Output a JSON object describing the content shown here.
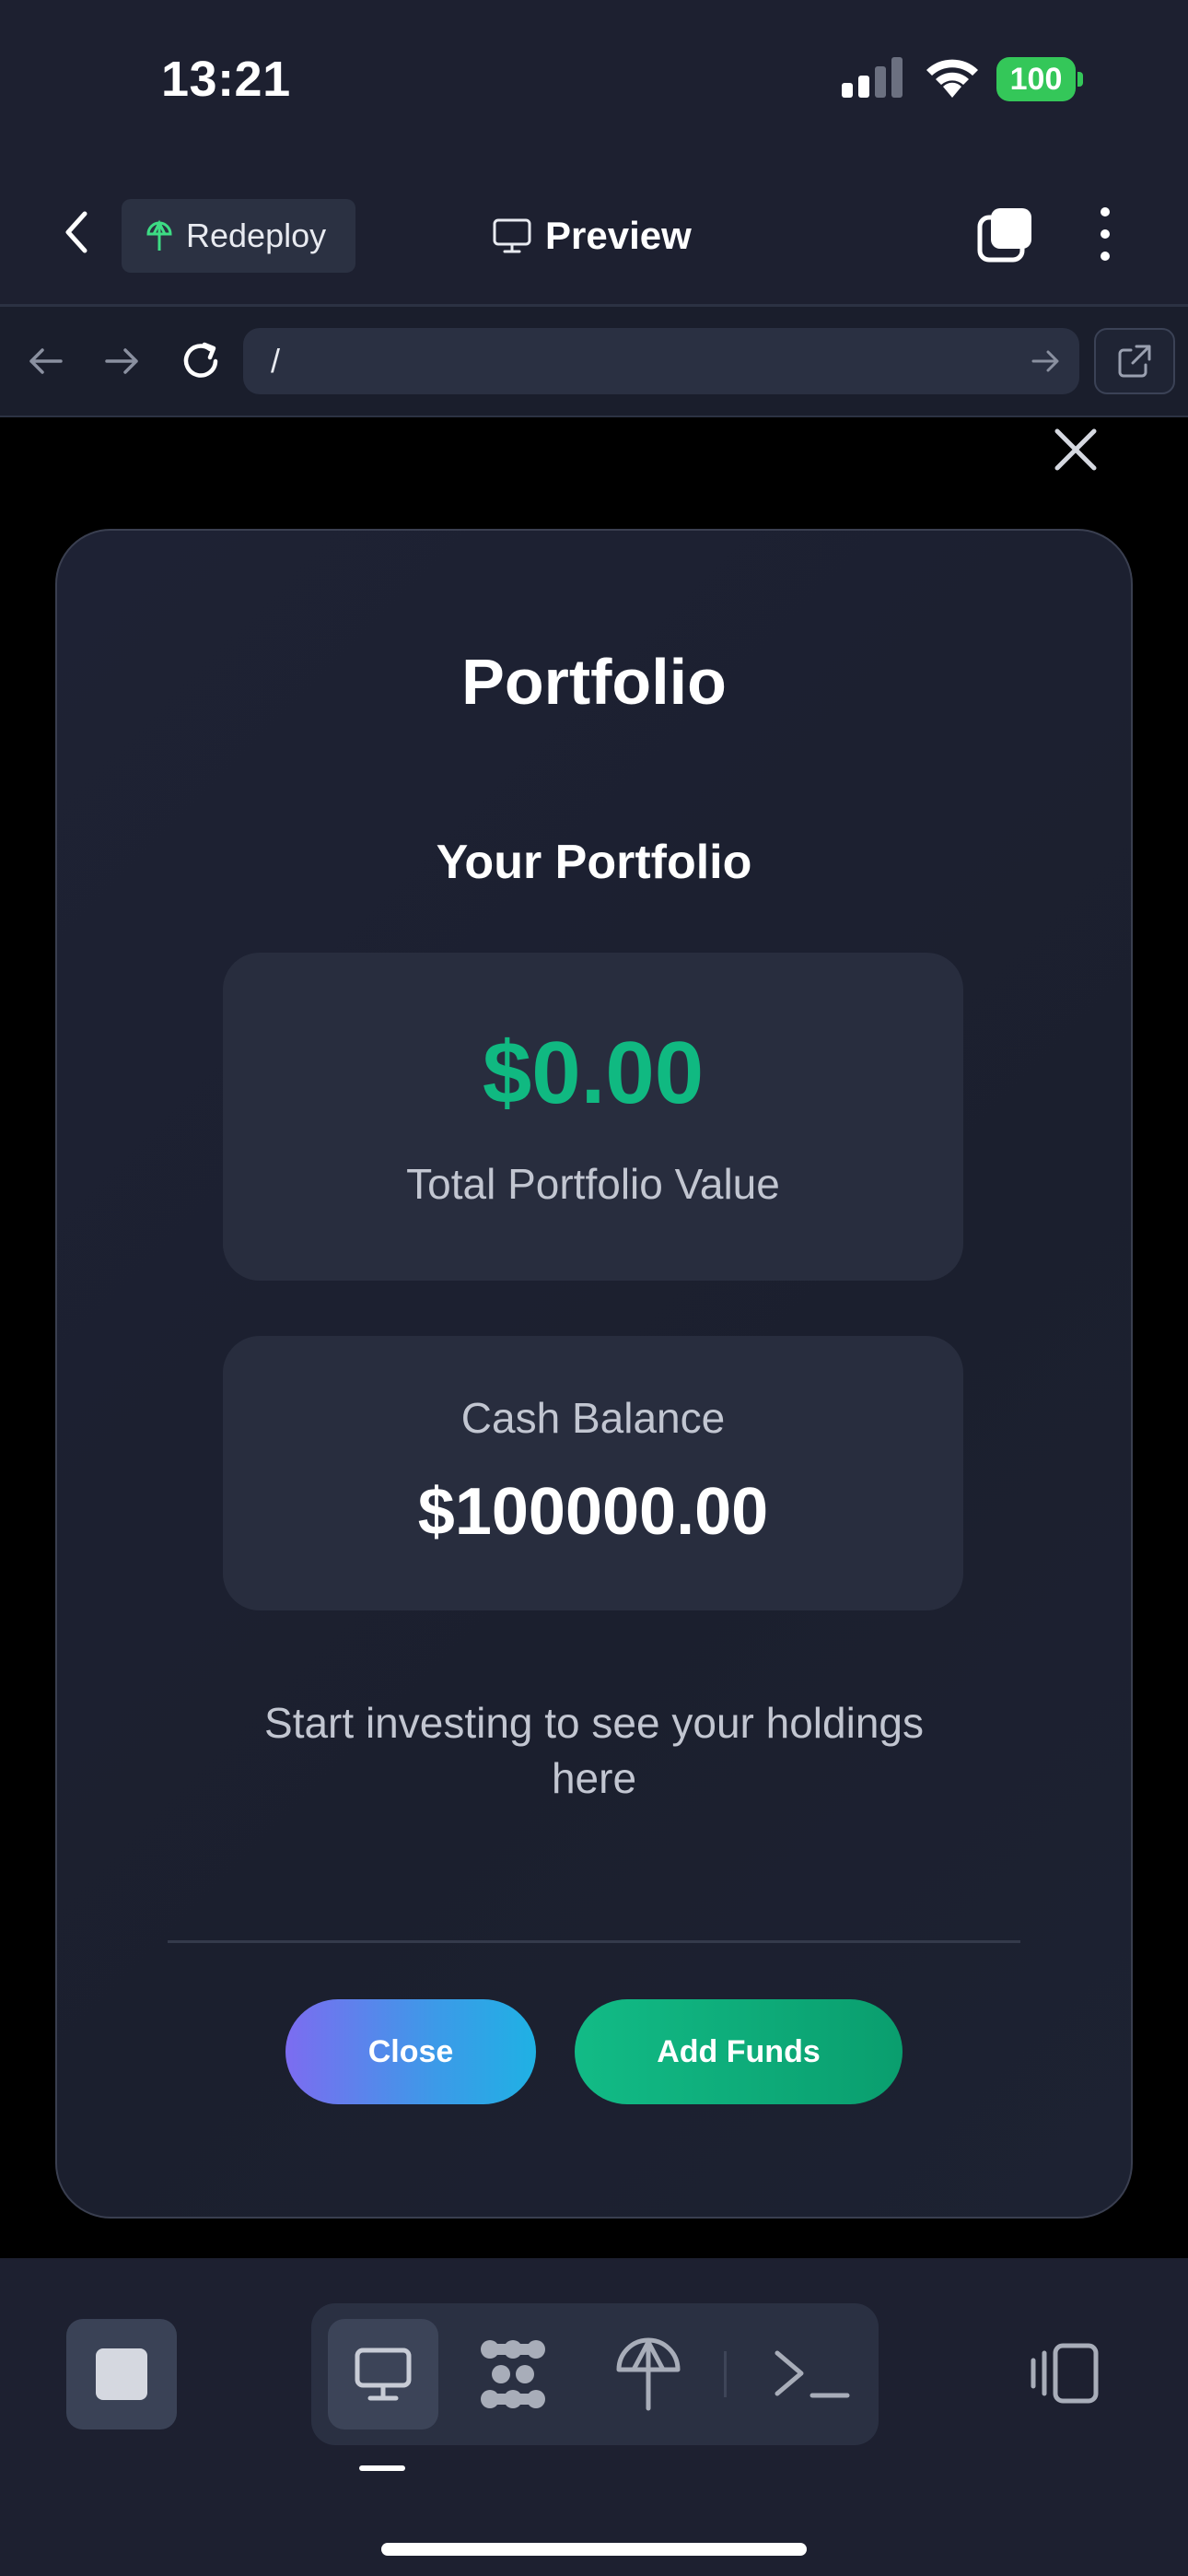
{
  "status_bar": {
    "time": "13:21",
    "battery": "100"
  },
  "header": {
    "redeploy_label": "Redeploy",
    "preview_label": "Preview"
  },
  "browser": {
    "url": "/"
  },
  "modal": {
    "title": "Portfolio",
    "section_title": "Your Portfolio",
    "total_value": "$0.00",
    "total_label": "Total Portfolio Value",
    "cash_label": "Cash Balance",
    "cash_value": "$100000.00",
    "empty_message": "Start investing to see your holdings here",
    "close_button": "Close",
    "add_funds_button": "Add Funds"
  },
  "toolbar": {
    "items": [
      "stop-icon",
      "desktop-icon",
      "ai-agent-icon",
      "deploy-icon",
      "shell-icon",
      "devices-icon"
    ],
    "active": "desktop-icon"
  },
  "colors": {
    "accent_green": "#10b981",
    "battery_green": "#34c759"
  }
}
